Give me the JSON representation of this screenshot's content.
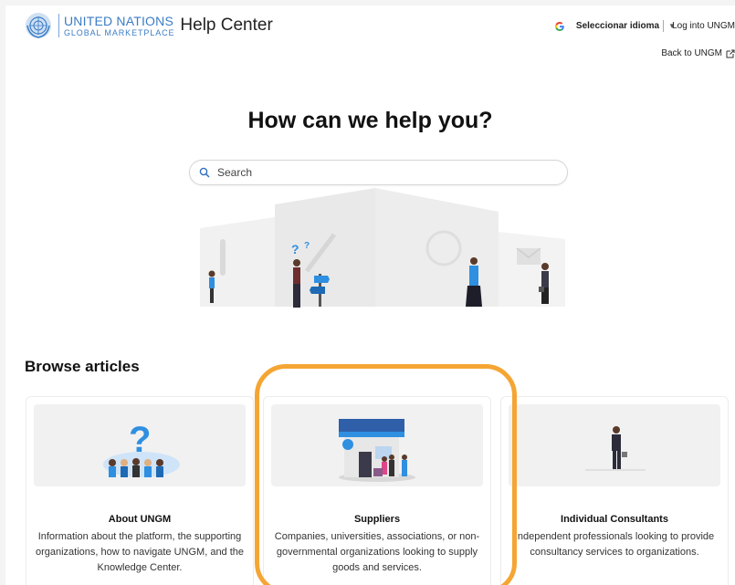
{
  "header": {
    "logo_line1": "UNITED NATIONS",
    "logo_line2": "GLOBAL MARKETPLACE",
    "help_center": "Help Center",
    "language_label": "Seleccionar idioma",
    "language_caret": "▼",
    "login": "Log into UNGM",
    "back": "Back to UNGM"
  },
  "hero": {
    "title": "How can we help you?",
    "search_placeholder": "Search"
  },
  "browse": {
    "title": "Browse articles",
    "cards": [
      {
        "title": "About UNGM",
        "description": "Information about the platform, the supporting organizations, how to navigate UNGM, and the Knowledge Center."
      },
      {
        "title": "Suppliers",
        "description": "Companies, universities, associations, or non-governmental organizations looking to supply goods and services."
      },
      {
        "title": "Individual Consultants",
        "description": "Independent professionals looking to provide consultancy services to organizations."
      }
    ]
  },
  "colors": {
    "brand_blue": "#3b7dc4",
    "highlight_orange": "#f5a533",
    "accent_blue": "#2f8fe0"
  },
  "icons": [
    "un-emblem-icon",
    "google-icon",
    "external-link-icon",
    "search-icon",
    "question-people-icon",
    "store-icon",
    "consultant-icon"
  ]
}
